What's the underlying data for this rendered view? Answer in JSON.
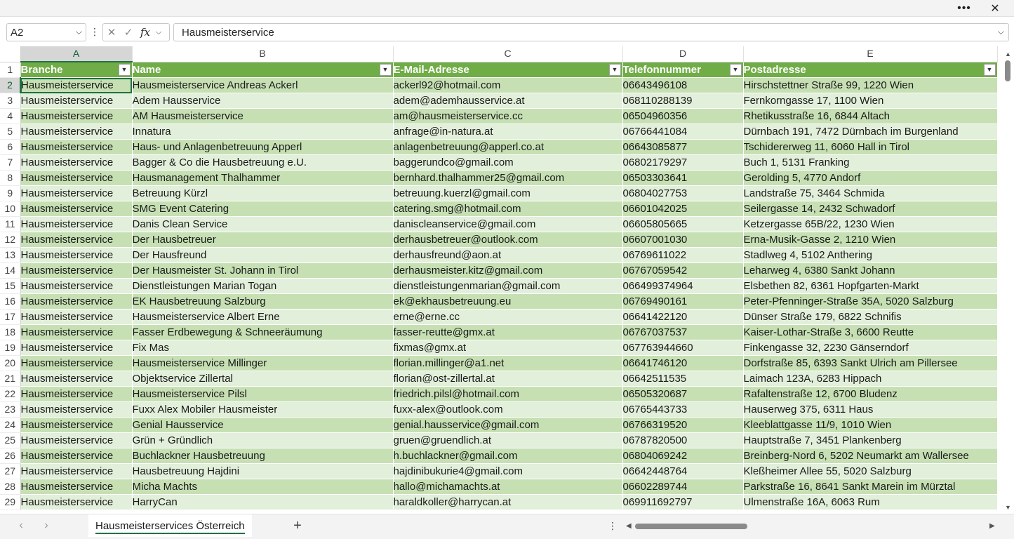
{
  "window": {
    "more_icon": "ellipsis-icon",
    "close_icon": "close-icon"
  },
  "formula_bar": {
    "name_box": "A2",
    "formula": "Hausmeisterservice"
  },
  "grid": {
    "columns": [
      "A",
      "B",
      "C",
      "D",
      "E"
    ],
    "selected_column": "A",
    "header_row": [
      "Branche",
      "Name",
      "E-Mail-Adresse",
      "Telefonnummer",
      "Postadresse"
    ],
    "rows": [
      {
        "n": "2",
        "c": [
          "Hausmeisterservice",
          "Hausmeisterservice Andreas Ackerl",
          "ackerl92@hotmail.com",
          "06643496108",
          "Hirschstettner Straße 99, 1220 Wien"
        ]
      },
      {
        "n": "3",
        "c": [
          "Hausmeisterservice",
          "Adem Hausservice",
          "adem@ademhausservice.at",
          "068110288139",
          "Fernkorngasse 17, 1100 Wien"
        ]
      },
      {
        "n": "4",
        "c": [
          "Hausmeisterservice",
          "AM Hausmeisterservice",
          "am@hausmeisterservice.cc",
          "06504960356",
          "Rhetikusstraße 16, 6844 Altach"
        ]
      },
      {
        "n": "5",
        "c": [
          "Hausmeisterservice",
          "Innatura",
          "anfrage@in-natura.at",
          "06766441084",
          "Dürnbach 191, 7472 Dürnbach im Burgenland"
        ]
      },
      {
        "n": "6",
        "c": [
          "Hausmeisterservice",
          "Haus- und Anlagenbetreuung Apperl",
          "anlagenbetreuung@apperl.co.at",
          "06643085877",
          "Tschidererweg 11, 6060 Hall in Tirol"
        ]
      },
      {
        "n": "7",
        "c": [
          "Hausmeisterservice",
          "Bagger & Co die Hausbetreuung e.U.",
          "baggerundco@gmail.com",
          "06802179297",
          "Buch 1, 5131 Franking"
        ]
      },
      {
        "n": "8",
        "c": [
          "Hausmeisterservice",
          "Hausmanagement Thalhammer",
          "bernhard.thalhammer25@gmail.com",
          "06503303641",
          "Gerolding 5, 4770 Andorf"
        ]
      },
      {
        "n": "9",
        "c": [
          "Hausmeisterservice",
          "Betreuung Kürzl",
          "betreuung.kuerzl@gmail.com",
          "06804027753",
          "Landstraße 75, 3464 Schmida"
        ]
      },
      {
        "n": "10",
        "c": [
          "Hausmeisterservice",
          "SMG Event Catering",
          "catering.smg@hotmail.com",
          "06601042025",
          "Seilergasse 14, 2432 Schwadorf"
        ]
      },
      {
        "n": "11",
        "c": [
          "Hausmeisterservice",
          "Danis Clean Service",
          "daniscleanservice@gmail.com",
          "06605805665",
          "Ketzergasse 65B/22, 1230 Wien"
        ]
      },
      {
        "n": "12",
        "c": [
          "Hausmeisterservice",
          "Der Hausbetreuer",
          "derhausbetreuer@outlook.com",
          "06607001030",
          "Erna-Musik-Gasse 2, 1210 Wien"
        ]
      },
      {
        "n": "13",
        "c": [
          "Hausmeisterservice",
          "Der Hausfreund",
          "derhausfreund@aon.at",
          "06769611022",
          "Stadlweg 4, 5102 Anthering"
        ]
      },
      {
        "n": "14",
        "c": [
          "Hausmeisterservice",
          "Der Hausmeister St. Johann in Tirol",
          "derhausmeister.kitz@gmail.com",
          "06767059542",
          "Leharweg 4, 6380 Sankt Johann"
        ]
      },
      {
        "n": "15",
        "c": [
          "Hausmeisterservice",
          "Dienstleistungen Marian Togan",
          "dienstleistungenmarian@gmail.com",
          "066499374964",
          "Elsbethen 82, 6361 Hopfgarten-Markt"
        ]
      },
      {
        "n": "16",
        "c": [
          "Hausmeisterservice",
          "EK Hausbetreuung Salzburg",
          "ek@ekhausbetreuung.eu",
          "06769490161",
          "Peter-Pfenninger-Straße 35A, 5020 Salzburg"
        ]
      },
      {
        "n": "17",
        "c": [
          "Hausmeisterservice",
          "Hausmeisterservice Albert Erne",
          "erne@erne.cc",
          "06641422120",
          "Dünser Straße 179, 6822 Schnifis"
        ]
      },
      {
        "n": "18",
        "c": [
          "Hausmeisterservice",
          "Fasser Erdbewegung & Schneeräumung",
          "fasser-reutte@gmx.at",
          "06767037537",
          "Kaiser-Lothar-Straße 3, 6600 Reutte"
        ]
      },
      {
        "n": "19",
        "c": [
          "Hausmeisterservice",
          "Fix Mas",
          "fixmas@gmx.at",
          "067763944660",
          "Finkengasse 32, 2230 Gänserndorf"
        ]
      },
      {
        "n": "20",
        "c": [
          "Hausmeisterservice",
          "Hausmeisterservice Millinger",
          "florian.millinger@a1.net",
          "06641746120",
          "Dorfstraße 85, 6393 Sankt Ulrich am Pillersee"
        ]
      },
      {
        "n": "21",
        "c": [
          "Hausmeisterservice",
          "Objektservice Zillertal",
          "florian@ost-zillertal.at",
          "06642511535",
          "Laimach 123A, 6283 Hippach"
        ]
      },
      {
        "n": "22",
        "c": [
          "Hausmeisterservice",
          "Hausmeisterservice Pilsl",
          "friedrich.pilsl@hotmail.com",
          "06505320687",
          "Rafaltenstraße 12, 6700 Bludenz"
        ]
      },
      {
        "n": "23",
        "c": [
          "Hausmeisterservice",
          "Fuxx Alex Mobiler Hausmeister",
          "fuxx-alex@outlook.com",
          "06765443733",
          "Hauserweg 375, 6311 Haus"
        ]
      },
      {
        "n": "24",
        "c": [
          "Hausmeisterservice",
          "Genial Hausservice",
          "genial.hausservice@gmail.com",
          "06766319520",
          "Kleeblattgasse 11/9, 1010 Wien"
        ]
      },
      {
        "n": "25",
        "c": [
          "Hausmeisterservice",
          "Grün + Gründlich",
          "gruen@gruendlich.at",
          "06787820500",
          "Hauptstraße 7, 3451 Plankenberg"
        ]
      },
      {
        "n": "26",
        "c": [
          "Hausmeisterservice",
          "Buchlackner Hausbetreuung",
          "h.buchlackner@gmail.com",
          "06804069242",
          "Breinberg-Nord 6, 5202 Neumarkt am Wallersee"
        ]
      },
      {
        "n": "27",
        "c": [
          "Hausmeisterservice",
          "Hausbetreuung Hajdini",
          "hajdinibukurie4@gmail.com",
          "06642448764",
          "Kleßheimer Allee 55, 5020 Salzburg"
        ]
      },
      {
        "n": "28",
        "c": [
          "Hausmeisterservice",
          "Micha Machts",
          "hallo@michamachts.at",
          "06602289744",
          "Parkstraße 16, 8641 Sankt Marein im Mürztal"
        ]
      },
      {
        "n": "29",
        "c": [
          "Hausmeisterservice",
          "HarryCan",
          "haraldkoller@harrycan.at",
          "069911692797",
          "Ulmenstraße 16A, 6063 Rum"
        ]
      }
    ]
  },
  "sheet_tabs": {
    "active_tab": "Hausmeisterservices Österreich",
    "add_label": "+"
  },
  "colors": {
    "header_green": "#70ad47",
    "band_dark": "#c6e0b4",
    "band_light": "#e2efda",
    "accent": "#217346"
  }
}
